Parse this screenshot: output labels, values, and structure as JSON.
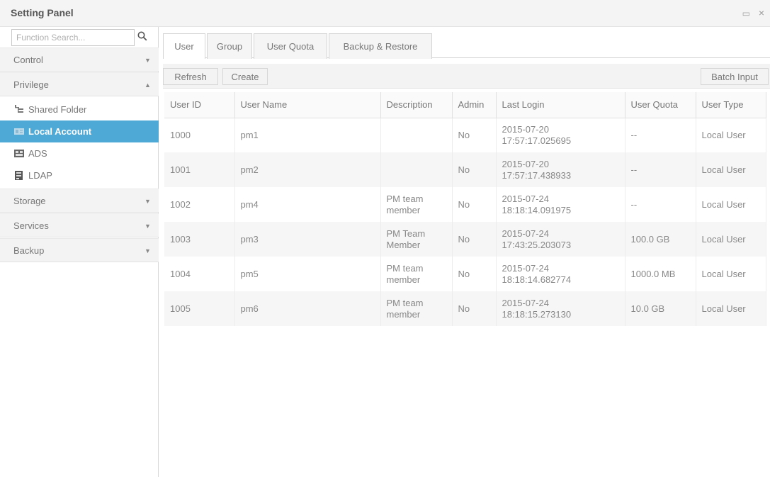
{
  "window": {
    "title": "Setting Panel",
    "maximize_glyph": "▭",
    "close_glyph": "×"
  },
  "sidebar": {
    "search": {
      "placeholder": "Function Search..."
    },
    "categories": {
      "control": {
        "label": "Control",
        "arrow": "▼"
      },
      "privilege": {
        "label": "Privilege",
        "arrow": "▲"
      },
      "storage": {
        "label": "Storage",
        "arrow": "▼"
      },
      "services": {
        "label": "Services",
        "arrow": "▼"
      },
      "backup": {
        "label": "Backup",
        "arrow": "▼"
      }
    },
    "privilege_items": [
      {
        "label": "Shared Folder",
        "icon": "shared-folder-icon"
      },
      {
        "label": "Local Account",
        "icon": "local-account-icon",
        "active": true
      },
      {
        "label": "ADS",
        "icon": "ads-icon"
      },
      {
        "label": "LDAP",
        "icon": "ldap-icon"
      }
    ]
  },
  "main": {
    "tabs": [
      "User",
      "Group",
      "User Quota",
      "Backup & Restore"
    ],
    "active_tab": "User",
    "toolbar": {
      "refresh": "Refresh",
      "create": "Create",
      "batch_input": "Batch Input"
    },
    "table": {
      "headers": [
        "User ID",
        "User Name",
        "Description",
        "Admin",
        "Last Login",
        "User Quota",
        "User Type"
      ],
      "rows": [
        {
          "id": "1000",
          "name": "pm1",
          "desc1": "",
          "desc2": "",
          "admin": "No",
          "login_date": "2015-07-20",
          "login_time": "17:57:17.025695",
          "quota": "--",
          "type": "Local User"
        },
        {
          "id": "1001",
          "name": "pm2",
          "desc1": "",
          "desc2": "",
          "admin": "No",
          "login_date": "2015-07-20",
          "login_time": "17:57:17.438933",
          "quota": "--",
          "type": "Local User"
        },
        {
          "id": "1002",
          "name": "pm4",
          "desc1": "PM team",
          "desc2": "member",
          "admin": "No",
          "login_date": "2015-07-24",
          "login_time": "18:18:14.091975",
          "quota": "--",
          "type": "Local User"
        },
        {
          "id": "1003",
          "name": "pm3",
          "desc1": "PM Team",
          "desc2": "Member",
          "admin": "No",
          "login_date": "2015-07-24",
          "login_time": "17:43:25.203073",
          "quota": "100.0 GB",
          "type": "Local User"
        },
        {
          "id": "1004",
          "name": "pm5",
          "desc1": "PM team",
          "desc2": "member",
          "admin": "No",
          "login_date": "2015-07-24",
          "login_time": "18:18:14.682774",
          "quota": "1000.0 MB",
          "type": "Local User"
        },
        {
          "id": "1005",
          "name": "pm6",
          "desc1": "PM team",
          "desc2": "member",
          "admin": "No",
          "login_date": "2015-07-24",
          "login_time": "18:18:15.273130",
          "quota": "10.0 GB",
          "type": "Local User"
        }
      ]
    }
  },
  "colors": {
    "accent": "#4fa9d6",
    "panel_bg": "#f3f3f3",
    "border": "#d7d7d7"
  }
}
